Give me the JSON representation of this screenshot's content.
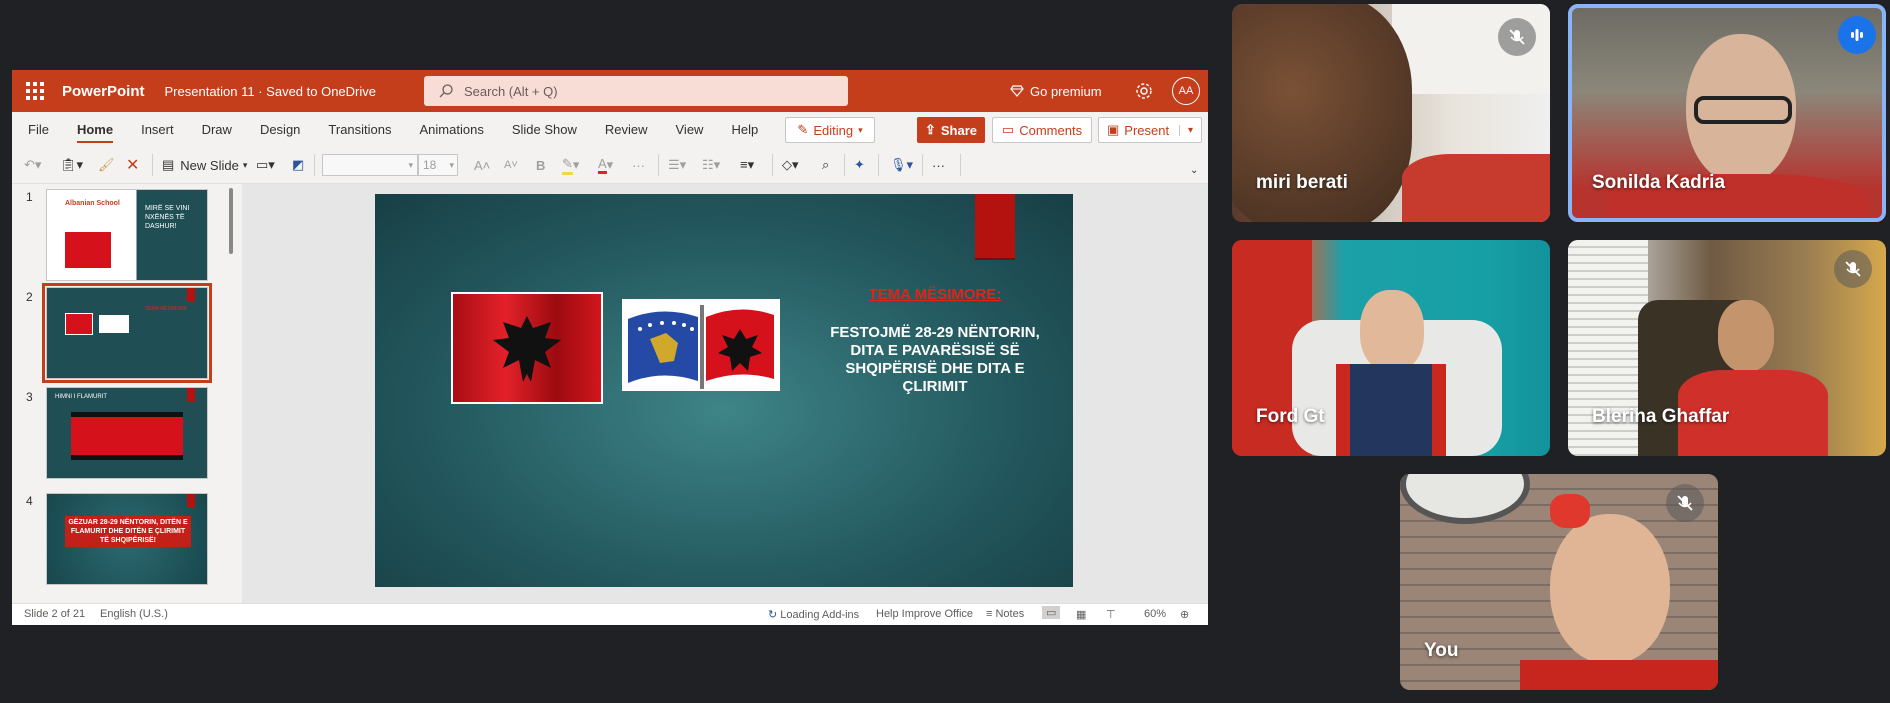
{
  "powerpoint": {
    "app_name": "PowerPoint",
    "doc_title": "Presentation 11 · Saved to OneDrive",
    "search_placeholder": "Search (Alt + Q)",
    "premium_label": "Go premium",
    "avatar_initials": "AA",
    "menu_tabs": [
      "File",
      "Home",
      "Insert",
      "Draw",
      "Design",
      "Transitions",
      "Animations",
      "Slide Show",
      "Review",
      "View",
      "Help"
    ],
    "active_tab": "Home",
    "editing_label": "Editing",
    "share_label": "Share",
    "comments_label": "Comments",
    "present_label": "Present",
    "ribbon": {
      "new_slide_label": "New Slide",
      "font_size": "18"
    },
    "thumbnails": [
      {
        "number": "1",
        "title": "Albanian School",
        "text": "MIRË SE VINI NXËNËS TË DASHUR!"
      },
      {
        "number": "2",
        "title": "TEMA MËSIMORE",
        "text": ""
      },
      {
        "number": "3",
        "title": "HIMNI I FLAMURIT",
        "text": ""
      },
      {
        "number": "4",
        "title": "",
        "text": "GËZUAR 28-29 NËNTORIN, DITËN E FLAMURIT DHE DITËN E ÇLIRIMIT TË SHQIPËRISË!"
      }
    ],
    "slide": {
      "heading": "TEMA MËSIMORE:",
      "body": "FESTOJMË 28-29 NËNTORIN, DITA E PAVARËSISË SË SHQIPËRISË DHE DITA E ÇLIRIMIT"
    },
    "status": {
      "slide_count": "Slide 2 of 21",
      "language": "English (U.S.)",
      "addins": "Loading Add-ins",
      "help_improve": "Help Improve Office",
      "notes": "Notes",
      "zoom": "60%"
    },
    "colors": {
      "brand": "#c43e1c",
      "slide_bg": "#245a60",
      "heading_red": "#e2231a"
    }
  },
  "participants": [
    {
      "name": "miri berati",
      "muted": true
    },
    {
      "name": "Sonilda Kadria",
      "muted": false,
      "speaking": true
    },
    {
      "name": "Ford Gt",
      "muted": false
    },
    {
      "name": "Blerina Ghaffar",
      "muted": true
    },
    {
      "name": "You",
      "muted": true
    }
  ]
}
